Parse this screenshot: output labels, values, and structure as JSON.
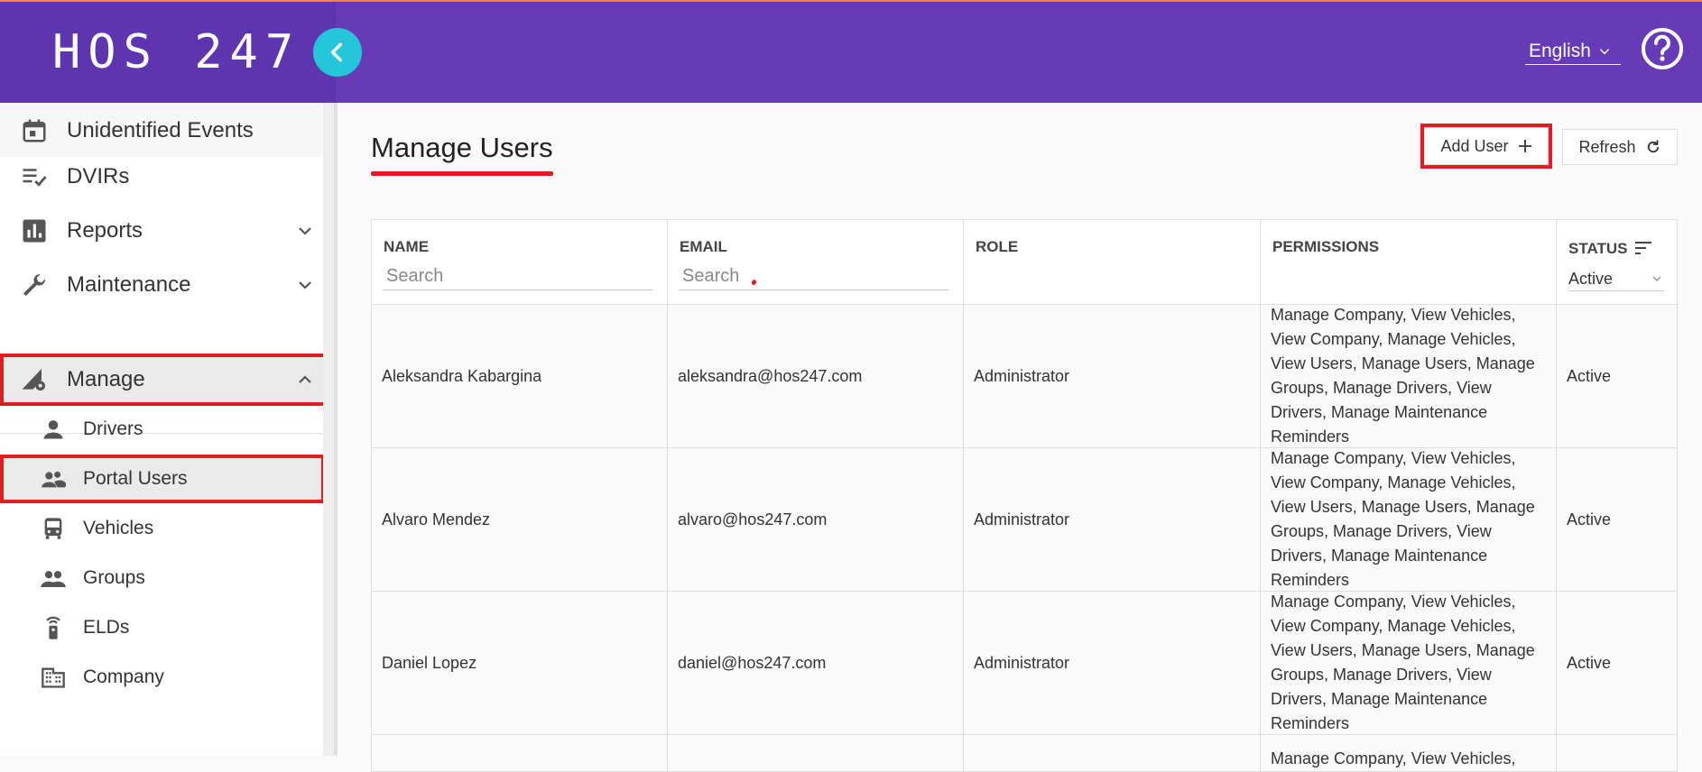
{
  "header": {
    "logo": "HOS 247",
    "language": "English"
  },
  "sidebar": {
    "items": [
      {
        "label": "Unidentified Events",
        "icon": "calendar-icon"
      },
      {
        "label": "DVIRs",
        "icon": "checklist-icon"
      },
      {
        "label": "Reports",
        "icon": "bar-chart-icon"
      },
      {
        "label": "Maintenance",
        "icon": "wrench-icon"
      },
      {
        "label": "Manage",
        "icon": "manage-gear-icon"
      }
    ],
    "manage_sub": [
      {
        "label": "Drivers",
        "icon": "person-icon"
      },
      {
        "label": "Portal Users",
        "icon": "supervisor-account-icon"
      },
      {
        "label": "Vehicles",
        "icon": "bus-icon"
      },
      {
        "label": "Groups",
        "icon": "people-icon"
      },
      {
        "label": "ELDs",
        "icon": "eld-device-icon"
      },
      {
        "label": "Company",
        "icon": "building-icon"
      }
    ]
  },
  "main": {
    "title": "Manage Users",
    "add_user_label": "Add User",
    "refresh_label": "Refresh",
    "table": {
      "columns": [
        "NAME",
        "EMAIL",
        "ROLE",
        "PERMISSIONS",
        "STATUS"
      ],
      "name_search_placeholder": "Search",
      "email_search_placeholder": "Search",
      "status_filter_value": "Active",
      "rows": [
        {
          "name": "Aleksandra Kabargina",
          "email": "aleksandra@hos247.com",
          "role": "Administrator",
          "permissions": "Manage Company, View Vehicles, View Company, Manage Vehicles, View Users, Manage Users, Manage Groups, Manage Drivers, View Drivers, Manage Maintenance Reminders",
          "status": "Active"
        },
        {
          "name": "Alvaro Mendez",
          "email": "alvaro@hos247.com",
          "role": "Administrator",
          "permissions": "Manage Company, View Vehicles, View Company, Manage Vehicles, View Users, Manage Users, Manage Groups, Manage Drivers, View Drivers, Manage Maintenance Reminders",
          "status": "Active"
        },
        {
          "name": "Daniel Lopez",
          "email": "daniel@hos247.com",
          "role": "Administrator",
          "permissions": "Manage Company, View Vehicles, View Company, Manage Vehicles, View Users, Manage Users, Manage Groups, Manage Drivers, View Drivers, Manage Maintenance Reminders",
          "status": "Active"
        },
        {
          "permissions": "Manage Company, View Vehicles,"
        }
      ]
    }
  },
  "colors": {
    "header": "#673ab7",
    "logo_panel": "#5e35b1",
    "collapse_button": "#26c6da",
    "highlight": "#e31b23"
  }
}
